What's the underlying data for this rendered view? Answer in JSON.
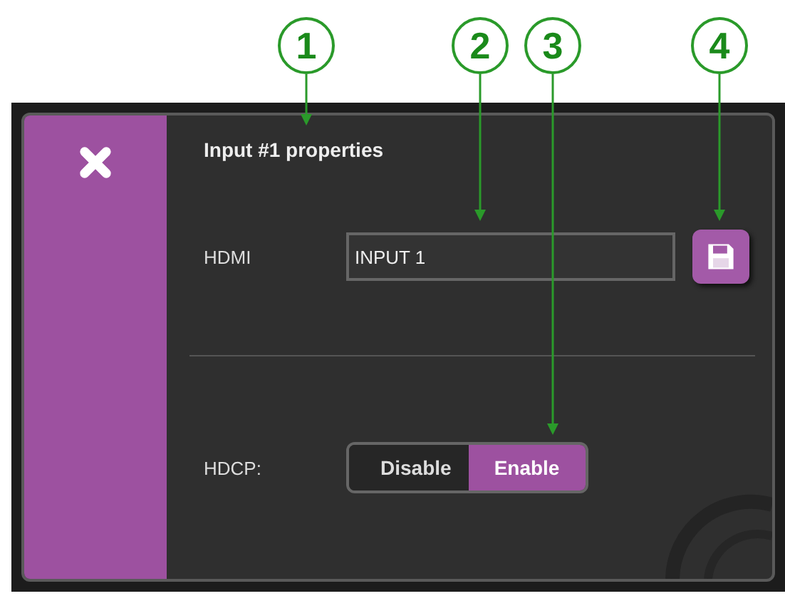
{
  "callouts": [
    {
      "label": "1"
    },
    {
      "label": "2"
    },
    {
      "label": "3"
    },
    {
      "label": "4"
    }
  ],
  "dialog": {
    "title": "Input #1 properties",
    "name_row": {
      "label": "HDMI",
      "value": "INPUT 1"
    },
    "hdcp": {
      "label": "HDCP:",
      "options": [
        {
          "label": "Disable",
          "selected": false
        },
        {
          "label": "Enable",
          "selected": true
        }
      ]
    }
  }
}
